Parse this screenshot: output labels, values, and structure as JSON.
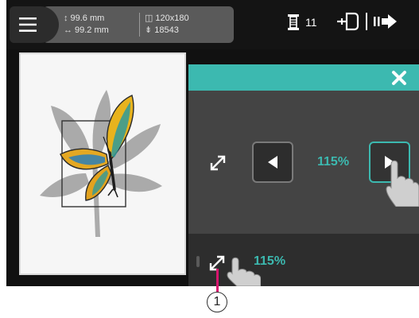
{
  "info": {
    "height": "99.6 mm",
    "width": "99.2 mm",
    "hoop_size": "120x180",
    "stitch_count": "18543"
  },
  "status": {
    "thread_count": "11"
  },
  "resize": {
    "value": "115%"
  },
  "strip": {
    "value": "115%"
  },
  "callout": {
    "number": "1"
  },
  "colors": {
    "accent": "#3cb9b0",
    "callout_line": "#d7156e"
  }
}
